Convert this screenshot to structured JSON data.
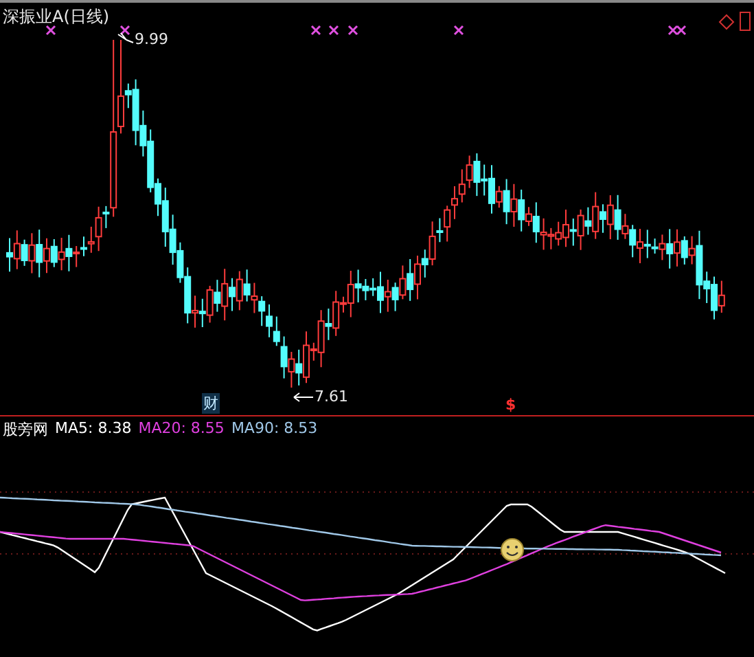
{
  "chart": {
    "title": "深振业A(日线)",
    "high_label": "9.99",
    "low_label": "7.61",
    "event_marks": [
      {
        "kind": "finance",
        "text": "财"
      },
      {
        "kind": "dollar",
        "text": "$"
      }
    ]
  },
  "indicator": {
    "name": "股旁网",
    "lines": [
      {
        "label": "MA5: 8.38",
        "color": "#ffffff"
      },
      {
        "label": "MA20: 8.55",
        "color": "#e040e0"
      },
      {
        "label": "MA90: 8.53",
        "color": "#a0c8e8"
      }
    ]
  }
}
